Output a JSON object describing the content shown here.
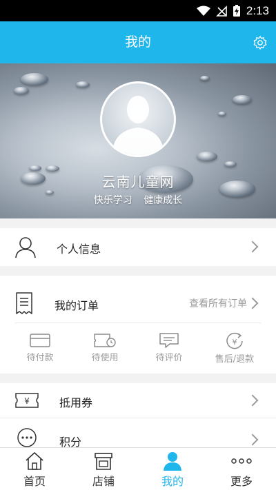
{
  "status_bar": {
    "time": "2:13"
  },
  "header": {
    "title": "我的"
  },
  "profile": {
    "name": "云南儿童网",
    "slogan_left": "快乐学习",
    "slogan_right": "健康成长"
  },
  "menu": {
    "personal_info": "个人信息",
    "orders": {
      "title": "我的订单",
      "view_all": "查看所有订单"
    },
    "order_status": [
      {
        "label": "待付款",
        "icon": "card-icon"
      },
      {
        "label": "待使用",
        "icon": "ticket-clock-icon"
      },
      {
        "label": "待评价",
        "icon": "comment-icon"
      },
      {
        "label": "售后/退款",
        "icon": "refund-icon"
      }
    ],
    "coupon": "抵用券",
    "points": "积分"
  },
  "tabs": [
    {
      "label": "首页",
      "icon": "home-icon"
    },
    {
      "label": "店铺",
      "icon": "store-icon"
    },
    {
      "label": "我的",
      "icon": "user-icon",
      "active": true
    },
    {
      "label": "更多",
      "icon": "more-icon"
    }
  ],
  "colors": {
    "accent": "#1fb6ec"
  }
}
